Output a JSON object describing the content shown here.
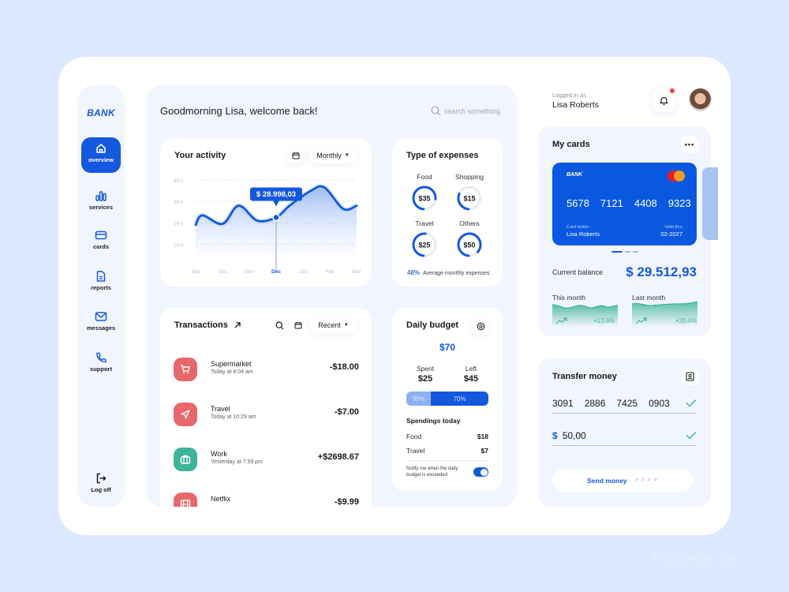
{
  "sidebar": {
    "brand": "BANK",
    "items": [
      {
        "label": "overview",
        "icon": "home-icon",
        "active": true
      },
      {
        "label": "services",
        "icon": "bar-chart-icon",
        "active": false
      },
      {
        "label": "cards",
        "icon": "credit-card-icon",
        "active": false
      },
      {
        "label": "reports",
        "icon": "document-icon",
        "active": false
      },
      {
        "label": "messages",
        "icon": "mail-icon",
        "active": false
      },
      {
        "label": "support",
        "icon": "phone-icon",
        "active": false
      }
    ],
    "logout": {
      "label": "Log off",
      "icon": "logout-icon"
    }
  },
  "header": {
    "greeting": "Goodmorning Lisa, welcome back!",
    "search_placeholder": "search something"
  },
  "activity": {
    "title": "Your activity",
    "period": "Monthly",
    "tooltip": "$ 28.998,03",
    "highlighted_month": "Dec"
  },
  "chart_data": {
    "type": "area",
    "title": "Your activity",
    "xlabel": "",
    "ylabel": "",
    "categories": [
      "Sep",
      "Oct",
      "Nov",
      "Dec",
      "Jan",
      "Feb",
      "Mar"
    ],
    "y_ticks": [
      "10 k",
      "20 k",
      "30 k",
      "40 k"
    ],
    "ylim": [
      5000,
      40000
    ],
    "grid": true,
    "series": [
      {
        "name": "Activity",
        "x": [
          0,
          0.25,
          1,
          1.6,
          2.3,
          3,
          3.5,
          4.3,
          4.8,
          5.5,
          6
        ],
        "values": [
          19000,
          23500,
          19500,
          28000,
          21000,
          22500,
          28000,
          35000,
          36500,
          26500,
          28000
        ]
      }
    ],
    "highlight": {
      "category": "Dec",
      "label": "$ 28.998,03"
    },
    "colors": {
      "line": "#0f5ad9",
      "fill": "#dce8fd"
    }
  },
  "expenses": {
    "title": "Type of expenses",
    "items": [
      {
        "name": "Food",
        "value": "$35",
        "fraction": 0.75
      },
      {
        "name": "Shopping",
        "value": "$15",
        "fraction": 0.3
      },
      {
        "name": "Travel",
        "value": "$25",
        "fraction": 0.5
      },
      {
        "name": "Others",
        "value": "$50",
        "fraction": 0.85
      }
    ],
    "average_percent": "48%",
    "average_label": "Average monthly expenses"
  },
  "transactions": {
    "title": "Transactions",
    "filter": "Recent",
    "items": [
      {
        "name": "Supermarket",
        "time": "Today at 8:04 am",
        "amount": "-$18.00",
        "icon": "cart-icon",
        "color": "#e8676a"
      },
      {
        "name": "Travel",
        "time": "Today at 10:29 am",
        "amount": "-$7.00",
        "icon": "navigation-icon",
        "color": "#e8676a"
      },
      {
        "name": "Work",
        "time": "Yesterday at 7:59 pm",
        "amount": "+$2698.67",
        "icon": "briefcase-icon",
        "color": "#3fb49a"
      },
      {
        "name": "Netflix",
        "time": "",
        "amount": "-$9.99",
        "icon": "film-icon",
        "color": "#e8676a"
      }
    ]
  },
  "budget": {
    "title": "Daily budget",
    "total": "$70",
    "spent_label": "Spent",
    "spent": "$25",
    "left_label": "Left",
    "left": "$45",
    "spent_percent": "30%",
    "left_percent": "70%",
    "spent_fraction": 0.3,
    "today_title": "Spendings today",
    "today": [
      {
        "name": "Food",
        "amount": "$18"
      },
      {
        "name": "Travel",
        "amount": "$7"
      }
    ],
    "notify_text": "Notify me when the daily budget is exceeded",
    "notify_enabled": true
  },
  "user": {
    "logged_label": "Logged in as",
    "name": "Lisa Roberts",
    "has_notification": true
  },
  "cards": {
    "title": "My cards",
    "card": {
      "brand": "BANK",
      "number": [
        "5678",
        "7121",
        "4408",
        "9323"
      ],
      "holder_label": "Card holder",
      "holder": "Lisa Roberts",
      "valid_label": "Valid thru",
      "valid": "02-2027"
    },
    "balance_label": "Current balance",
    "balance": "$ 29.512,93",
    "this_month_label": "This month",
    "this_month_change": "+13.6%",
    "last_month_label": "Last month",
    "last_month_change": "+20.4%"
  },
  "transfer": {
    "title": "Transfer money",
    "account": [
      "3091",
      "2886",
      "7425",
      "0903"
    ],
    "currency": "$",
    "amount": "50,00",
    "button": "Send money",
    "button_arrows": "> > > >"
  },
  "colors": {
    "primary": "#1458de",
    "accent_red": "#e8676a",
    "accent_green": "#3fb49a",
    "panel": "#f1f5fe",
    "background": "#dce8fd"
  },
  "watermark": "TOOOPEN.com"
}
